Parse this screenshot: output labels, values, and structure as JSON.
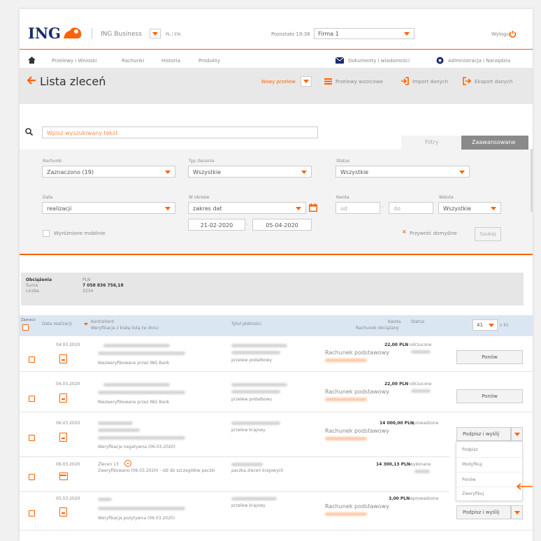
{
  "brand": {
    "logo_text": "ING",
    "product": "ING Business",
    "lang": "PL | EN",
    "remaining": "Pozostało 19:38",
    "company": "Firma 1",
    "logout": "Wyloguj"
  },
  "nav": {
    "items": [
      "Przelewy i Wnioski",
      "Rachunki",
      "Historia",
      "Produkty"
    ],
    "documents": "Dokumenty i wiadomości",
    "admin": "Administracja i Narzędzia"
  },
  "title_bar": {
    "title": "Lista zleceń",
    "new_transfer": "Nowy przelew",
    "templates": "Przelewy wzorcowe",
    "import": "Import danych",
    "export": "Eksport danych"
  },
  "search": {
    "placeholder": "Wpisz wyszukiwany tekst"
  },
  "filter_tabs": {
    "filters": "Filtry",
    "advanced": "Zaawansowane"
  },
  "filters": {
    "accounts_label": "Rachunki",
    "accounts_value": "Zaznaczono (19)",
    "type_label": "Typ zlecenia",
    "type_value": "Wszystkie",
    "status_label": "Status",
    "status_value": "Wszystkie",
    "date_label": "Data",
    "date_value": "realizacji",
    "period_label": "W okresie",
    "period_value": "zakres dat",
    "date_from": "21-02-2020",
    "date_to": "05-04-2020",
    "dash": "-",
    "amount_label": "Kwota",
    "amount_from": "od",
    "amount_to": "do",
    "currency_label": "Waluta",
    "currency_value": "Wszystkie",
    "mobile_label": "Wyróżnione mobilnie",
    "reset": "Przywróć domyślne",
    "search_btn": "Szukaj"
  },
  "summary": {
    "title": "Obciążenia",
    "sum_label": "Suma",
    "count_label": "Liczba",
    "currency": "PLN",
    "sum": "7 058 836 756,18",
    "count": "3234"
  },
  "table": {
    "col_select": "Zaznacz",
    "col_date": "Data realizacji",
    "col_contractor": "Kontrahent",
    "col_contractor_sub": "Weryfikacja z białą listą (w dniu)",
    "col_title": "Tytuł płatności",
    "col_amount": "Kwota",
    "col_account": "Rachunek obciążany",
    "col_status": "Status",
    "page_size": "41",
    "page_info": "z 41"
  },
  "rows": [
    {
      "date": "04.03.2020",
      "verify": "Niezweryfikowane przez ING Bank",
      "title": "przelew podatkowy",
      "amount": "22,00 PLN",
      "account": "Rachunek podstawowy",
      "status": "odrzucone",
      "action": "Ponów"
    },
    {
      "date": "04.03.2020",
      "verify": "Niezweryfikowane przez ING Bank",
      "title": "przelew podatkowy",
      "amount": "22,00 PLN",
      "account": "Rachunek podstawowy",
      "status": "odrzucone",
      "action": "Ponów"
    },
    {
      "date": "06.03.2020",
      "verify": "Weryfikacja negatywna (06.03.2020)",
      "title": "przelew krajowy",
      "amount": "14 000,00 PLN",
      "account": "Rachunek podstawowy",
      "status": "wprowadzone",
      "action": "Podpisz i wyślij"
    },
    {
      "date": "06.03.2020",
      "package": "Zlecen 13",
      "verify": "Zweryfikowano (06.03.2020) - idź do szczegółów paczki",
      "title": "paczka zleceń krajowych",
      "amount": "14 300,13 PLN",
      "status": "wykonane"
    },
    {
      "date": "05.03.2020",
      "verify": "Weryfikacja pozytywna (06.03.2020)",
      "title": "przelew krajowy",
      "amount": "3,00 PLN",
      "account": "Rachunek podstawowy",
      "status": "wprowadzone",
      "action": "Podpisz i wyślij"
    }
  ],
  "menu": {
    "items": [
      "Podpisz",
      "Modyfikuj",
      "Ponów",
      "Zweryfikuj"
    ]
  },
  "colors": {
    "accent": "#ff6200",
    "header_band": "#e8e8e8",
    "table_header": "#dbe6f3"
  }
}
